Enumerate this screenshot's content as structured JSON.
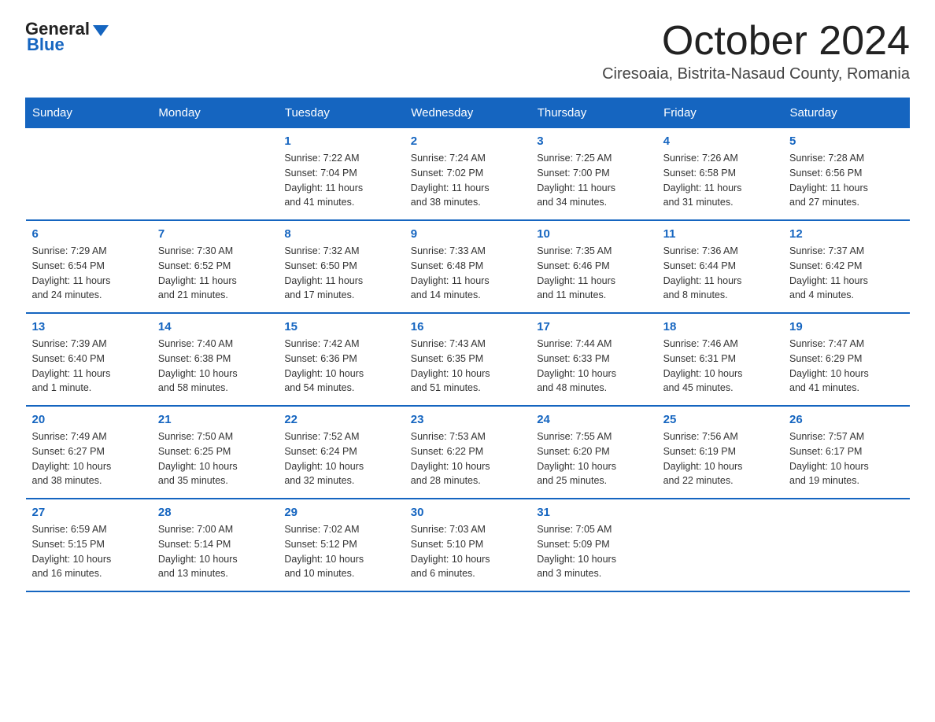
{
  "header": {
    "logo_general": "General",
    "logo_blue": "Blue",
    "month_title": "October 2024",
    "location": "Ciresoaia, Bistrita-Nasaud County, Romania"
  },
  "weekdays": [
    "Sunday",
    "Monday",
    "Tuesday",
    "Wednesday",
    "Thursday",
    "Friday",
    "Saturday"
  ],
  "weeks": [
    [
      {
        "day": "",
        "info": ""
      },
      {
        "day": "",
        "info": ""
      },
      {
        "day": "1",
        "info": "Sunrise: 7:22 AM\nSunset: 7:04 PM\nDaylight: 11 hours\nand 41 minutes."
      },
      {
        "day": "2",
        "info": "Sunrise: 7:24 AM\nSunset: 7:02 PM\nDaylight: 11 hours\nand 38 minutes."
      },
      {
        "day": "3",
        "info": "Sunrise: 7:25 AM\nSunset: 7:00 PM\nDaylight: 11 hours\nand 34 minutes."
      },
      {
        "day": "4",
        "info": "Sunrise: 7:26 AM\nSunset: 6:58 PM\nDaylight: 11 hours\nand 31 minutes."
      },
      {
        "day": "5",
        "info": "Sunrise: 7:28 AM\nSunset: 6:56 PM\nDaylight: 11 hours\nand 27 minutes."
      }
    ],
    [
      {
        "day": "6",
        "info": "Sunrise: 7:29 AM\nSunset: 6:54 PM\nDaylight: 11 hours\nand 24 minutes."
      },
      {
        "day": "7",
        "info": "Sunrise: 7:30 AM\nSunset: 6:52 PM\nDaylight: 11 hours\nand 21 minutes."
      },
      {
        "day": "8",
        "info": "Sunrise: 7:32 AM\nSunset: 6:50 PM\nDaylight: 11 hours\nand 17 minutes."
      },
      {
        "day": "9",
        "info": "Sunrise: 7:33 AM\nSunset: 6:48 PM\nDaylight: 11 hours\nand 14 minutes."
      },
      {
        "day": "10",
        "info": "Sunrise: 7:35 AM\nSunset: 6:46 PM\nDaylight: 11 hours\nand 11 minutes."
      },
      {
        "day": "11",
        "info": "Sunrise: 7:36 AM\nSunset: 6:44 PM\nDaylight: 11 hours\nand 8 minutes."
      },
      {
        "day": "12",
        "info": "Sunrise: 7:37 AM\nSunset: 6:42 PM\nDaylight: 11 hours\nand 4 minutes."
      }
    ],
    [
      {
        "day": "13",
        "info": "Sunrise: 7:39 AM\nSunset: 6:40 PM\nDaylight: 11 hours\nand 1 minute."
      },
      {
        "day": "14",
        "info": "Sunrise: 7:40 AM\nSunset: 6:38 PM\nDaylight: 10 hours\nand 58 minutes."
      },
      {
        "day": "15",
        "info": "Sunrise: 7:42 AM\nSunset: 6:36 PM\nDaylight: 10 hours\nand 54 minutes."
      },
      {
        "day": "16",
        "info": "Sunrise: 7:43 AM\nSunset: 6:35 PM\nDaylight: 10 hours\nand 51 minutes."
      },
      {
        "day": "17",
        "info": "Sunrise: 7:44 AM\nSunset: 6:33 PM\nDaylight: 10 hours\nand 48 minutes."
      },
      {
        "day": "18",
        "info": "Sunrise: 7:46 AM\nSunset: 6:31 PM\nDaylight: 10 hours\nand 45 minutes."
      },
      {
        "day": "19",
        "info": "Sunrise: 7:47 AM\nSunset: 6:29 PM\nDaylight: 10 hours\nand 41 minutes."
      }
    ],
    [
      {
        "day": "20",
        "info": "Sunrise: 7:49 AM\nSunset: 6:27 PM\nDaylight: 10 hours\nand 38 minutes."
      },
      {
        "day": "21",
        "info": "Sunrise: 7:50 AM\nSunset: 6:25 PM\nDaylight: 10 hours\nand 35 minutes."
      },
      {
        "day": "22",
        "info": "Sunrise: 7:52 AM\nSunset: 6:24 PM\nDaylight: 10 hours\nand 32 minutes."
      },
      {
        "day": "23",
        "info": "Sunrise: 7:53 AM\nSunset: 6:22 PM\nDaylight: 10 hours\nand 28 minutes."
      },
      {
        "day": "24",
        "info": "Sunrise: 7:55 AM\nSunset: 6:20 PM\nDaylight: 10 hours\nand 25 minutes."
      },
      {
        "day": "25",
        "info": "Sunrise: 7:56 AM\nSunset: 6:19 PM\nDaylight: 10 hours\nand 22 minutes."
      },
      {
        "day": "26",
        "info": "Sunrise: 7:57 AM\nSunset: 6:17 PM\nDaylight: 10 hours\nand 19 minutes."
      }
    ],
    [
      {
        "day": "27",
        "info": "Sunrise: 6:59 AM\nSunset: 5:15 PM\nDaylight: 10 hours\nand 16 minutes."
      },
      {
        "day": "28",
        "info": "Sunrise: 7:00 AM\nSunset: 5:14 PM\nDaylight: 10 hours\nand 13 minutes."
      },
      {
        "day": "29",
        "info": "Sunrise: 7:02 AM\nSunset: 5:12 PM\nDaylight: 10 hours\nand 10 minutes."
      },
      {
        "day": "30",
        "info": "Sunrise: 7:03 AM\nSunset: 5:10 PM\nDaylight: 10 hours\nand 6 minutes."
      },
      {
        "day": "31",
        "info": "Sunrise: 7:05 AM\nSunset: 5:09 PM\nDaylight: 10 hours\nand 3 minutes."
      },
      {
        "day": "",
        "info": ""
      },
      {
        "day": "",
        "info": ""
      }
    ]
  ]
}
